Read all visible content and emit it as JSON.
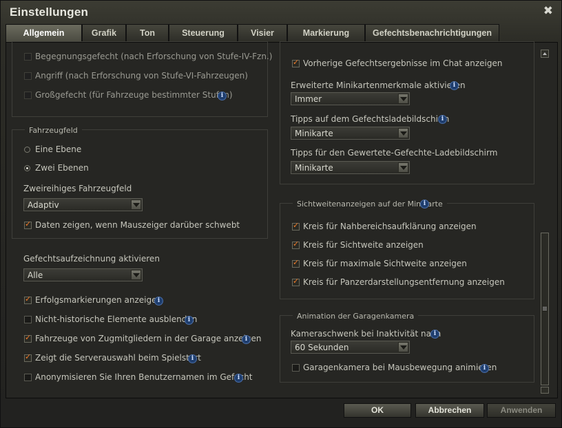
{
  "window": {
    "title": "Einstellungen",
    "close_glyph": "✖"
  },
  "tabs": [
    {
      "label": "Allgemein",
      "active": true
    },
    {
      "label": "Grafik"
    },
    {
      "label": "Ton"
    },
    {
      "label": "Steuerung"
    },
    {
      "label": "Visier"
    },
    {
      "label": "Markierung"
    },
    {
      "label": "Gefechtsbenachrichtigungen"
    }
  ],
  "left": {
    "battle_types": [
      {
        "label": "Begegnungsgefecht (nach Erforschung von Stufe-IV-Fzn.)",
        "checked": false
      },
      {
        "label": "Angriff (nach Erforschung von Stufe-VI-Fahrzeugen)",
        "checked": false
      },
      {
        "label": "Großgefecht (für Fahrzeuge bestimmter Stufen)",
        "checked": false,
        "info": true
      }
    ],
    "vehicle_panel": {
      "title": "Fahrzeugfeld",
      "option_one": "Eine Ebene",
      "option_two": "Zwei Ebenen",
      "selected": "Zwei Ebenen",
      "double_row_label": "Zweireihiges Fahrzeugfeld",
      "double_row_value": "Adaptiv",
      "hover_label": "Daten zeigen, wenn Mauszeiger darüber schwebt",
      "hover_checked": true
    },
    "replay": {
      "label": "Gefechtsaufzeichnung aktivieren",
      "value": "Alle"
    },
    "misc": [
      {
        "label": "Erfolgsmarkierungen anzeigen",
        "checked": true,
        "info": true
      },
      {
        "label": "Nicht-historische Elemente ausblenden",
        "checked": false,
        "info": true
      },
      {
        "label": "Fahrzeuge von Zugmitgliedern in der Garage anzeigen",
        "checked": true,
        "info": true
      },
      {
        "label": "Zeigt die Serverauswahl beim Spielstart",
        "checked": true,
        "info": true
      },
      {
        "label": "Anonymisieren Sie Ihren Benutzernamen im Gefecht",
        "checked": false,
        "info": true
      }
    ]
  },
  "right": {
    "prev_results": {
      "label": "Vorherige Gefechtsergebnisse im Chat anzeigen",
      "checked": true
    },
    "minimap_ext": {
      "label": "Erweiterte Minikartenmerkmale aktivieren",
      "value": "Immer"
    },
    "tips_loading": {
      "label": "Tipps auf dem Gefechtsladebildschirm",
      "value": "Minikarte"
    },
    "tips_ranked": {
      "label": "Tipps für den Gewertete-Gefechte-Ladebildschirm",
      "value": "Minikarte"
    },
    "view_range": {
      "title": "Sichtweitenanzeigen auf der Minikarte",
      "items": [
        {
          "label": "Kreis für Nahbereichsaufklärung anzeigen",
          "checked": true
        },
        {
          "label": "Kreis für Sichtweite anzeigen",
          "checked": true
        },
        {
          "label": "Kreis für maximale Sichtweite anzeigen",
          "checked": true
        },
        {
          "label": "Kreis für Panzerdarstellungsentfernung anzeigen",
          "checked": true
        }
      ]
    },
    "garage_cam": {
      "title": "Animation der Garagenkamera",
      "pan_label": "Kameraschwenk bei Inaktivität nach",
      "pan_value": "60 Sekunden",
      "mouse_label": "Garagenkamera bei Mausbewegung animieren",
      "mouse_checked": false
    }
  },
  "buttons": {
    "ok": "OK",
    "cancel": "Abbrechen",
    "apply": "Anwenden"
  },
  "icons": {
    "info": "i"
  },
  "colors": {
    "accent_check": "#f07a2a",
    "info_icon": "#1f3e6e"
  }
}
